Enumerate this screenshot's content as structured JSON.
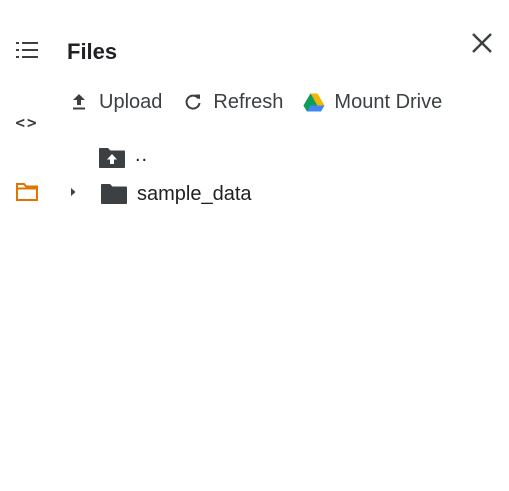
{
  "panel": {
    "title": "Files"
  },
  "rail": {
    "items": [
      {
        "icon": "table-of-contents-icon"
      },
      {
        "icon": "code-snippets-icon",
        "glyph": "<>"
      },
      {
        "icon": "folder-icon",
        "color": "#e37400"
      }
    ]
  },
  "toolbar": {
    "upload_label": "Upload",
    "refresh_label": "Refresh",
    "mount_drive_label": "Mount Drive"
  },
  "tree": {
    "parent_label": "..",
    "items": [
      {
        "label": "sample_data",
        "type": "folder",
        "expanded": false
      }
    ]
  },
  "colors": {
    "accent": "#e37400",
    "icon_gray": "#3c4043",
    "drive_green": "#0f9d58",
    "drive_yellow": "#f4b400",
    "drive_blue": "#4285f4"
  }
}
